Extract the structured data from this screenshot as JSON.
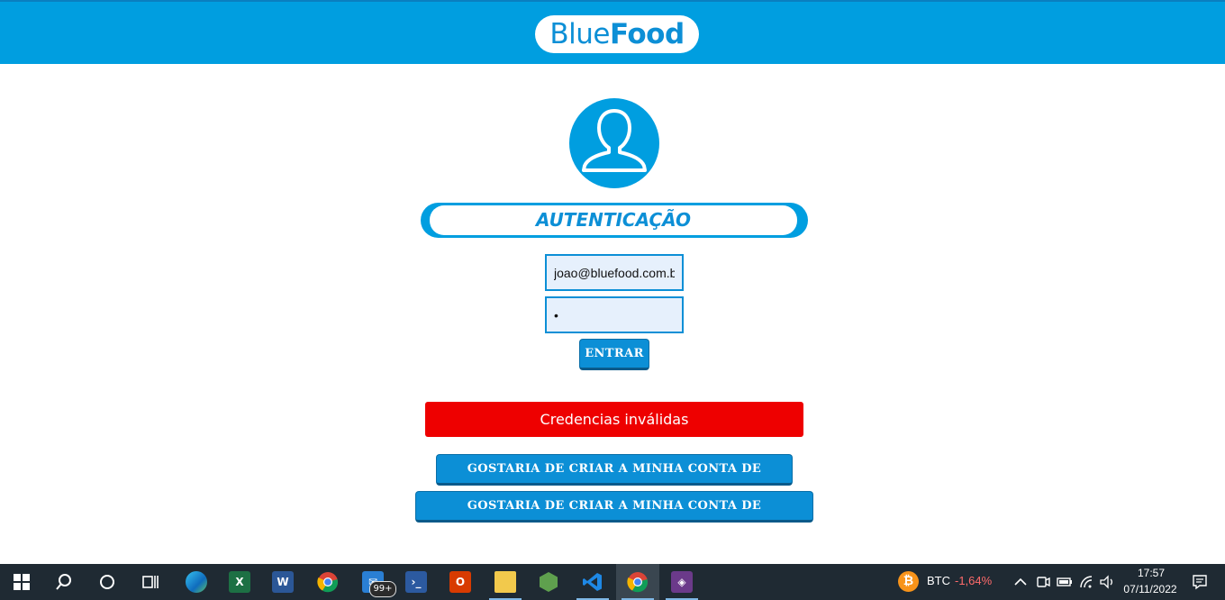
{
  "header": {
    "logo_light": "Blue",
    "logo_bold": "Food",
    "brand_color": "#009ee0"
  },
  "login": {
    "title": "AUTENTICAÇÃO",
    "email_value": "joao@bluefood.com.br",
    "password_value": "•",
    "submit_label": "ENTRAR",
    "error_message": "Credencias inválidas",
    "error_color": "#ee0000"
  },
  "signup": {
    "client_label": "GOSTARIA DE CRIAR A MINHA CONTA DE CLIENTE",
    "restaurant_label": "GOSTARIA DE CRIAR A MINHA CONTA DE RESTAURANTE"
  },
  "taskbar": {
    "apps": [
      "start",
      "search",
      "cortana",
      "task-view",
      "edge",
      "excel",
      "word",
      "chrome",
      "mail",
      "terminal",
      "office",
      "file-explorer",
      "node",
      "vscode",
      "chrome-active",
      "game"
    ],
    "mail_badge": "99+",
    "btc_label": "BTC",
    "btc_change": "-1,64%",
    "time": "17:57",
    "date": "07/11/2022"
  }
}
